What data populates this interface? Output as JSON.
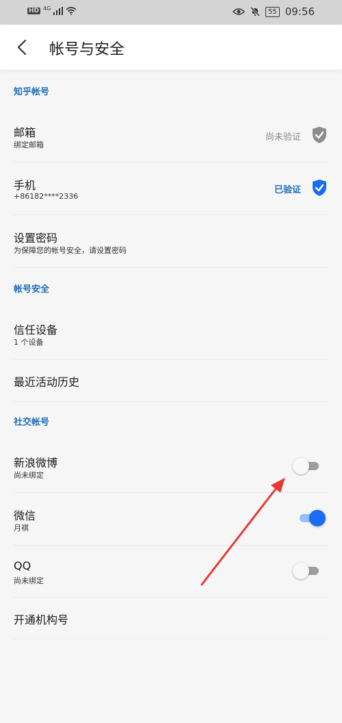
{
  "statusbar": {
    "left_badge": "HD",
    "network": "4G",
    "battery": "55",
    "time": "09:56"
  },
  "appbar": {
    "title": "帐号与安全"
  },
  "sections": {
    "zhihu_account": "知乎帐号",
    "account_security": "帐号安全",
    "social_accounts": "社交帐号"
  },
  "email": {
    "title": "邮箱",
    "subtitle": "绑定邮箱",
    "status": "尚未验证",
    "status_color": "#8a8a8a"
  },
  "phone": {
    "title": "手机",
    "subtitle": "+86182****2336",
    "status": "已验证",
    "status_color": "#1e6fb8"
  },
  "password": {
    "title": "设置密码",
    "subtitle": "为保障您的帐号安全，请设置密码"
  },
  "trusted_devices": {
    "title": "信任设备",
    "subtitle": "1 个设备"
  },
  "recent_activity": {
    "title": "最近活动历史"
  },
  "weibo": {
    "title": "新浪微博",
    "subtitle": "尚未绑定",
    "bound": false
  },
  "wechat": {
    "title": "微信",
    "subtitle": "月祺",
    "bound": true
  },
  "qq": {
    "title": "QQ",
    "subtitle": "尚未绑定",
    "bound": false
  },
  "org_account": {
    "title": "开通机构号"
  },
  "colors": {
    "accent": "#1e6fb8",
    "toggle_on": "#1a6cf0",
    "arrow": "#e53935"
  }
}
